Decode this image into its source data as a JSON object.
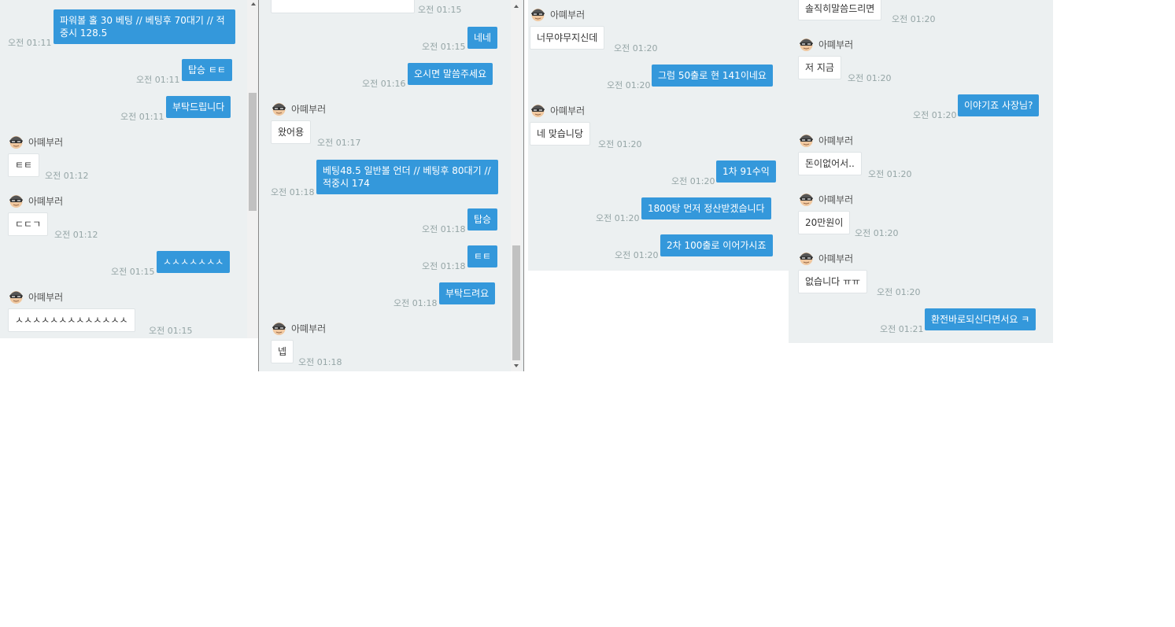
{
  "sender_name": "아뗴부러",
  "panels": [
    {
      "messages": [
        {
          "from": "me",
          "text": "파워볼 홀 30 베팅 // 베팅후 70대기 // 적중시 128.5",
          "time": "오전 01:11"
        },
        {
          "from": "me",
          "text": "탑승 ㅌㅌ",
          "time": "오전 01:11"
        },
        {
          "from": "me",
          "text": "부탁드립니다",
          "time": "오전 01:11"
        },
        {
          "from": "them",
          "text": "ㅌㅌ",
          "time": "오전 01:12"
        },
        {
          "from": "them",
          "text": "ㄷㄷㄱ",
          "time": "오전 01:12"
        },
        {
          "from": "me",
          "text": "ㅅㅅㅅㅅㅅㅅㅅ",
          "time": "오전 01:15"
        },
        {
          "from": "them",
          "text": "ㅅㅅㅅㅅㅅㅅㅅㅅㅅㅅㅅㅅㅅ",
          "time": "오전 01:15"
        }
      ]
    },
    {
      "messages": [
        {
          "from": "them",
          "text": "",
          "time": "오전 01:15"
        },
        {
          "from": "me",
          "text": "네네",
          "time": "오전 01:15"
        },
        {
          "from": "me",
          "text": "오시면 말씀주세요",
          "time": "오전 01:16"
        },
        {
          "from": "them",
          "text": "왔어용",
          "time": "오전 01:17"
        },
        {
          "from": "me",
          "text": "베팅48.5 일반볼 언더 // 베팅후 80대기 // 적중시 174",
          "time": "오전 01:18"
        },
        {
          "from": "me",
          "text": "탑승",
          "time": "오전 01:18"
        },
        {
          "from": "me",
          "text": "ㅌㅌ",
          "time": "오전 01:18"
        },
        {
          "from": "me",
          "text": "부탁드려요",
          "time": "오전 01:18"
        },
        {
          "from": "them",
          "text": "넵",
          "time": "오전 01:18"
        }
      ]
    },
    {
      "messages": [
        {
          "from": "them",
          "text": "너무야무지신데",
          "time": "오전 01:20"
        },
        {
          "from": "me",
          "text": "그럼 50출로 현 141이네요",
          "time": "오전 01:20"
        },
        {
          "from": "them",
          "text": "네 맞습니당",
          "time": "오전 01:20"
        },
        {
          "from": "me",
          "text": "1차 91수익",
          "time": "오전 01:20"
        },
        {
          "from": "me",
          "text": "1800탕 먼저 정산받겠습니다",
          "time": "오전 01:20"
        },
        {
          "from": "me",
          "text": "2차 100출로 이어가시죠",
          "time": "오전 01:20"
        }
      ]
    },
    {
      "messages": [
        {
          "from": "them",
          "text": "솔직히말씀드리면",
          "time": "오전 01:20"
        },
        {
          "from": "them",
          "text": "저 지금",
          "time": "오전 01:20"
        },
        {
          "from": "me",
          "text": "이야기죠 사장님?",
          "time": "오전 01:20"
        },
        {
          "from": "them",
          "text": "돈이없어서..",
          "time": "오전 01:20"
        },
        {
          "from": "them",
          "text": "20만원이",
          "time": "오전 01:20"
        },
        {
          "from": "them",
          "text": "없습니다 ㅠㅠ",
          "time": "오전 01:20"
        },
        {
          "from": "me",
          "text": "환전바로되신다면서요 ㅋ",
          "time": "오전 01:21"
        }
      ]
    }
  ]
}
